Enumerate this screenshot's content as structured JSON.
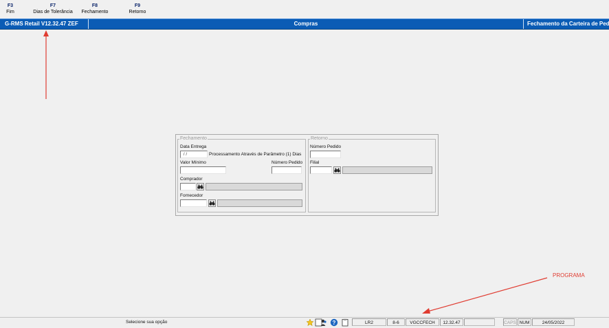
{
  "function_keys": [
    {
      "key": "F3",
      "label": "Fim"
    },
    {
      "key": "F7",
      "label": "Dias de Tolerância"
    },
    {
      "key": "F8",
      "label": "Fechamento"
    },
    {
      "key": "F9",
      "label": "Retorno"
    }
  ],
  "titlebar": {
    "left": "G-RMS Retail V12.32.47 ZEF",
    "center": "Compras",
    "right": "Fechamento da Carteira de Ped"
  },
  "form": {
    "fechamento": {
      "legend": "Fechamento",
      "data_entrega_label": "Data Entrega",
      "data_entrega_value": " / /",
      "processamento_text": "Processamento Através de Parâmetro (1) Dias",
      "valor_minimo_label": "Valor Mínimo",
      "valor_minimo_value": "",
      "numero_pedido_label": "Número Pedido",
      "numero_pedido_value": "",
      "comprador_label": "Comprador",
      "comprador_value": "",
      "comprador_desc": "",
      "fornecedor_label": "Fornecedor",
      "fornecedor_value": "",
      "fornecedor_desc": ""
    },
    "retorno": {
      "legend": "Retorno",
      "numero_pedido_label": "Número Pedido",
      "numero_pedido_value": "",
      "filial_label": "Filial",
      "filial_value": "",
      "filial_desc": ""
    }
  },
  "statusbar": {
    "message": "Selecione sua opção",
    "icons": [
      "star-icon",
      "users-icon",
      "help-icon",
      "clipboard-icon"
    ],
    "cells": [
      "LR2",
      "8-6",
      "VGCCFECH",
      "12.32.47",
      "",
      "CAPS",
      "NUM",
      "24/05/2022"
    ]
  },
  "annotations": {
    "programa_label": "PROGRAMA",
    "color": "#e03c31"
  },
  "colors": {
    "titlebar_bg": "#0b5cb5",
    "function_key": "#0a246a"
  }
}
